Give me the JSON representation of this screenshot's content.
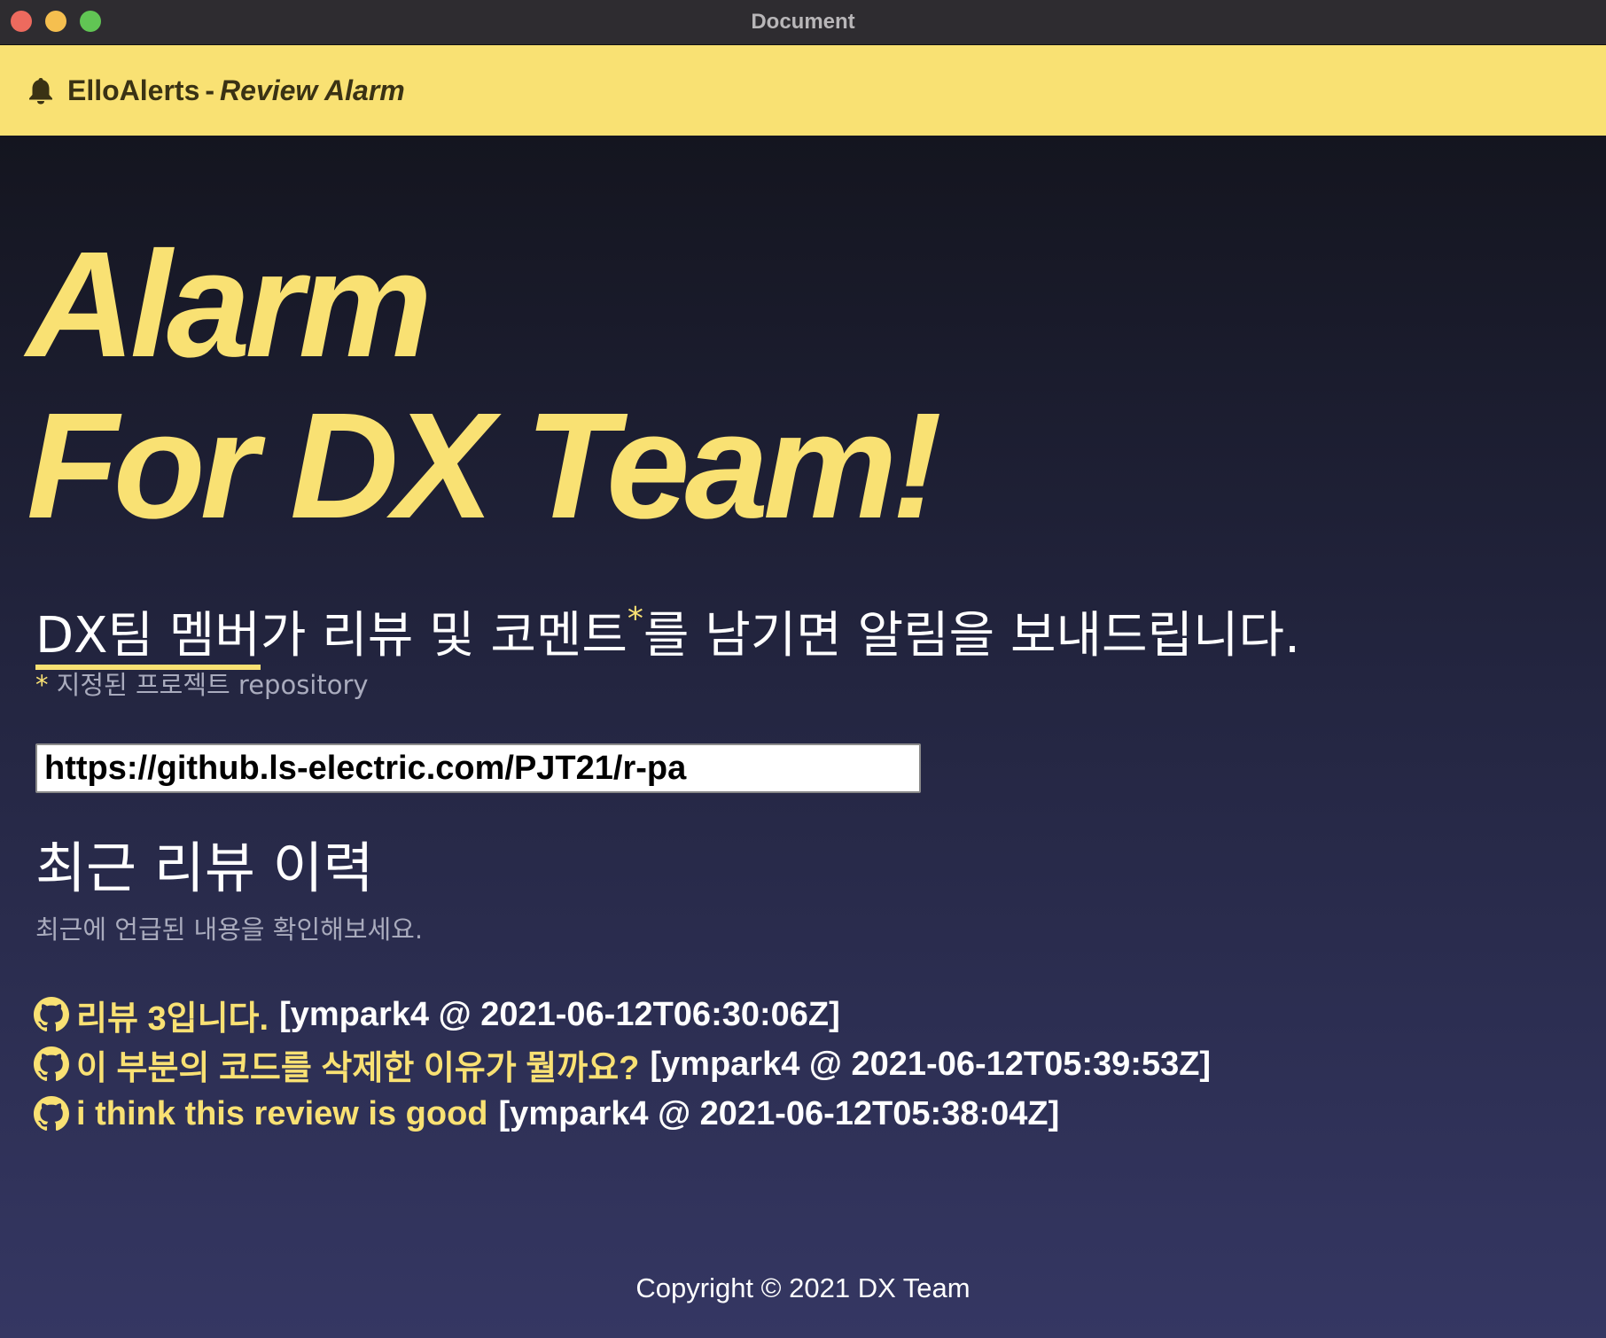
{
  "window": {
    "title": "Document"
  },
  "appbar": {
    "icon": "bell-icon",
    "brand": "ElloAlerts",
    "separator": "-",
    "subtitle": "Review Alarm",
    "background": "#f9e173"
  },
  "hero": {
    "line1": "Alarm",
    "line2": "For DX Team!",
    "color": "#f9e173"
  },
  "tagline": {
    "highlight": "DX팀 멤버",
    "middle": "가 리뷰 및 코멘트",
    "star": "*",
    "end": "를 남기면 알림을 보내드립니다."
  },
  "footnote": {
    "star": "*",
    "text": "지정된 프로젝트 repository"
  },
  "repo_input": {
    "value": "https://github.ls-electric.com/PJT21/r-pa"
  },
  "recent": {
    "title": "최근 리뷰 이력",
    "subtitle": "최근에 언급된 내용을 확인해보세요.",
    "items": [
      {
        "icon": "github-icon",
        "text": "리뷰 3입니다.",
        "meta": "[ympark4 @ 2021-06-12T06:30:06Z]"
      },
      {
        "icon": "github-icon",
        "text": "이 부분의 코드를 삭제한 이유가 뭘까요?",
        "meta": "[ympark4 @ 2021-06-12T05:39:53Z]"
      },
      {
        "icon": "github-icon",
        "text": "i think this review is good",
        "meta": "[ympark4 @ 2021-06-12T05:38:04Z]"
      }
    ]
  },
  "footer": {
    "copyright": "Copyright © 2021 DX Team"
  }
}
